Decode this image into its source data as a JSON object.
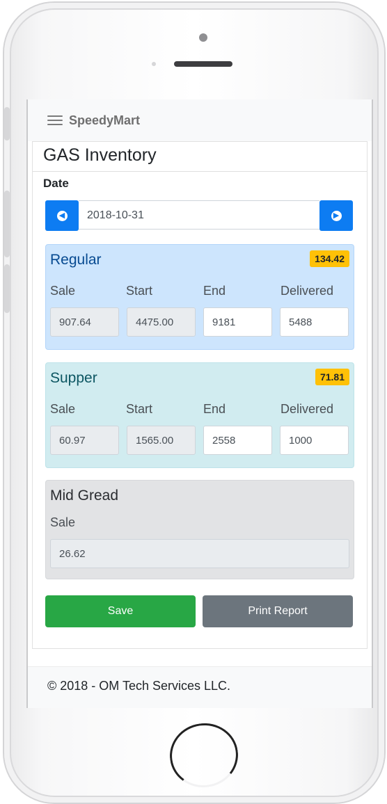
{
  "app": {
    "brand": "SpeedyMart"
  },
  "page": {
    "title": "GAS Inventory"
  },
  "date_picker": {
    "label": "Date",
    "value": "2018-10-31"
  },
  "columns": {
    "sale": "Sale",
    "start": "Start",
    "end": "End",
    "delivered": "Delivered"
  },
  "fuels": {
    "regular": {
      "name": "Regular",
      "badge": "134.42",
      "sale": "907.64",
      "start": "4475.00",
      "end": "9181",
      "delivered": "5488"
    },
    "supper": {
      "name": "Supper",
      "badge": "71.81",
      "sale": "60.97",
      "start": "1565.00",
      "end": "2558",
      "delivered": "1000"
    },
    "mid": {
      "name": "Mid Gread",
      "sale": "26.62"
    }
  },
  "actions": {
    "save_label": "Save",
    "print_label": "Print Report"
  },
  "footer": {
    "text": "© 2018 - OM Tech Services LLC."
  },
  "colors": {
    "primary": "#0d7cf2",
    "success": "#28a745",
    "secondary": "#6c757d",
    "warning": "#ffc107"
  },
  "icons": {
    "menu": "hamburger-icon",
    "prev": "circle-arrow-left-icon",
    "next": "circle-arrow-right-icon"
  }
}
